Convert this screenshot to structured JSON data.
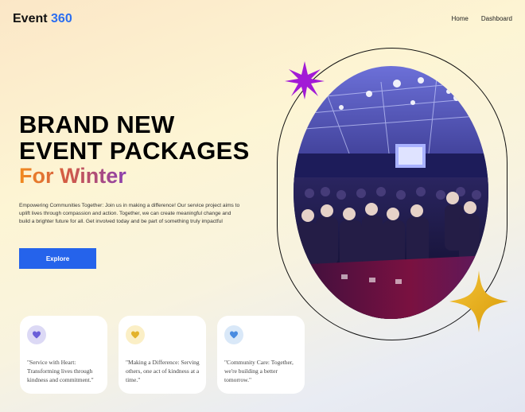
{
  "brand": {
    "name": "Event",
    "accent": "360"
  },
  "nav": {
    "links": [
      "Home",
      "Dashboard"
    ]
  },
  "hero": {
    "title_line1": "BRAND NEW",
    "title_line2": "EVENT PACKAGES",
    "subtitle": "For Winter",
    "description": "Empowering Communities Together: Join us in making a difference! Our service project aims to uplift lives through compassion and action. Together, we can create meaningful change and build a brighter future for all. Get involved today and be part of something truly impactful",
    "cta_label": "Explore"
  },
  "cards": [
    {
      "icon": "heart-icon",
      "quote": "\"Service with Heart: Transforming lives through kindness and commitment.\"",
      "color": "#6b5fd8",
      "bg": "#dcd9f5"
    },
    {
      "icon": "heart-icon",
      "quote": "\"Making a Difference: Serving others, one act of kindness at a time.\"",
      "color": "#e3b22a",
      "bg": "#fbefc6"
    },
    {
      "icon": "heart-icon",
      "quote": "\"Community Care: Together, we're building a better tomorrow.\"",
      "color": "#4a8ce0",
      "bg": "#d9e8f8"
    }
  ],
  "colors": {
    "accent": "#2563eb",
    "star_purple": "#a21ad6",
    "star_gold": "#e6a90e"
  }
}
